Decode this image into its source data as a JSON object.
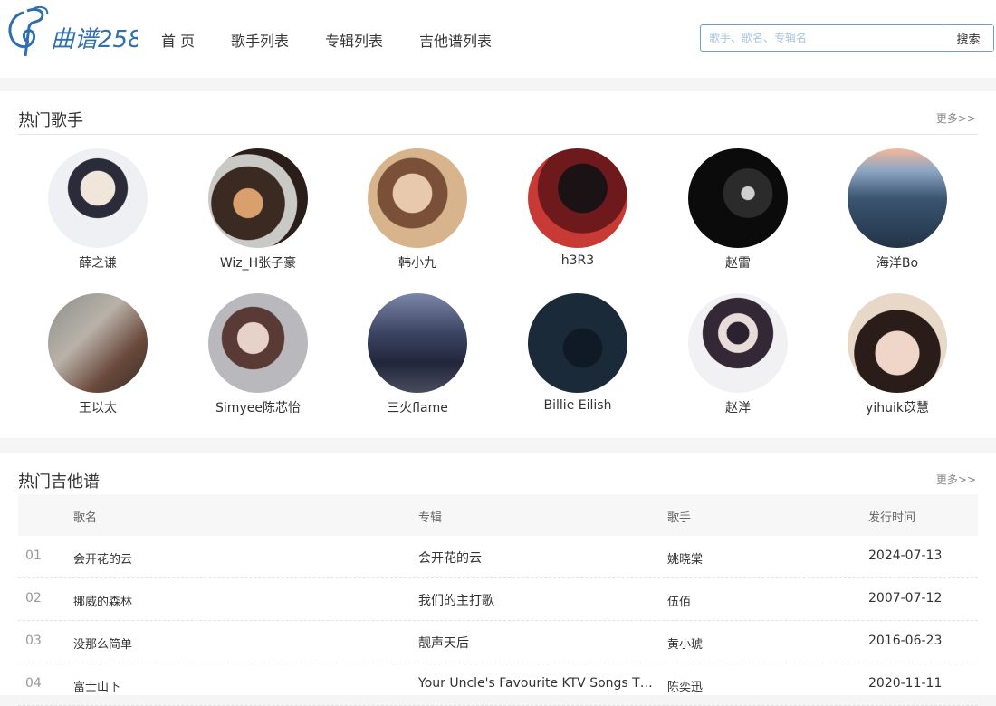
{
  "header": {
    "logo_text": "曲谱258",
    "nav": [
      "首 页",
      "歌手列表",
      "专辑列表",
      "吉他谱列表"
    ],
    "search": {
      "placeholder": "歌手、歌名、专辑名",
      "button_label": "搜索"
    }
  },
  "singers_section": {
    "title": "热门歌手",
    "more": "更多>>",
    "items": [
      {
        "name": "薛之谦"
      },
      {
        "name": "Wiz_H张子豪"
      },
      {
        "name": "韩小九"
      },
      {
        "name": "h3R3"
      },
      {
        "name": "赵雷"
      },
      {
        "name": "海洋Bo"
      },
      {
        "name": "王以太"
      },
      {
        "name": "Simyee陈芯怡"
      },
      {
        "name": "三火flame"
      },
      {
        "name": "Billie Eilish"
      },
      {
        "name": "赵洋"
      },
      {
        "name": "yihuik苡慧"
      }
    ]
  },
  "tabs_section": {
    "title": "热门吉他谱",
    "more": "更多>>",
    "columns": [
      "歌名",
      "专辑",
      "歌手",
      "发行时间"
    ],
    "rows": [
      {
        "num": "01",
        "song": "会开花的云",
        "album": "会开花的云",
        "artist": "姚晓棠",
        "date": "2024-07-13"
      },
      {
        "num": "02",
        "song": "挪威的森林",
        "album": "我们的主打歌",
        "artist": "伍佰",
        "date": "2007-07-12"
      },
      {
        "num": "03",
        "song": "没那么简单",
        "album": "靓声天后",
        "artist": "黄小琥",
        "date": "2016-06-23"
      },
      {
        "num": "04",
        "song": "富士山下",
        "album": "Your Uncle's Favourite KTV Songs Th...",
        "artist": "陈奕迅",
        "date": "2020-11-11"
      }
    ]
  },
  "colors": {
    "brand_blue": "#2f6fb0",
    "search_border": "#6b9ec8"
  }
}
